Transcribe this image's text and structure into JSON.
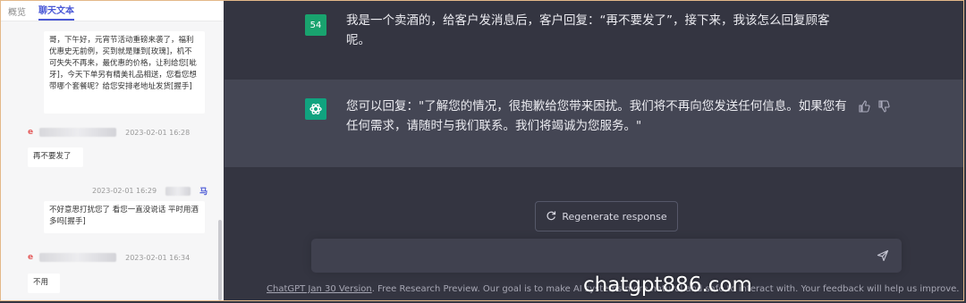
{
  "left_panel": {
    "tabs": [
      "概览",
      "聊天文本"
    ],
    "active_tab": 1,
    "messages": [
      {
        "text": "哥，下午好，元宵节活动重磅来袭了，福利优惠史无前例，买到就是赚到[玫瑰]，机不可失失不再来，最优惠的价格，让利给您[呲牙]，今天下单另有精美礼品相送，您看您想带哪个套餐呢？给您安排老地址发货[握手]"
      },
      {
        "marker": "e",
        "time": "2023-02-01 16:28",
        "text": "再不要发了"
      },
      {
        "time": "2023-02-01 16:29",
        "marker": "马",
        "text": "不好意思打扰您了 看您一直没说话 平时用酒多吗[握手]"
      },
      {
        "marker": "e",
        "time": "2023-02-01 16:34",
        "text": "不用"
      }
    ]
  },
  "chat": {
    "user_avatar": "54",
    "user_message": "我是一个卖酒的，给客户发消息后，客户回复：“再不要发了”，接下来，我该怎么回复顾客呢。",
    "assistant_message": "您可以回复：\"了解您的情况，很抱歉给您带来困扰。我们将不再向您发送任何信息。如果您有任何需求，请随时与我们联系。我们将竭诚为您服务。\"",
    "regenerate_label": "Regenerate response",
    "input_placeholder": "",
    "footer_link": "ChatGPT Jan 30 Version",
    "footer_text": ". Free Research Preview. Our goal is to make AI systems more natural and safe to interact with. Your feedback will help us improve.",
    "icons": [
      "openai-logo-icon",
      "thumbs-up-icon",
      "thumbs-down-icon",
      "refresh-icon",
      "send-icon"
    ]
  },
  "watermark": "chatgpt886.com",
  "colors": {
    "accent": "#4a58d6",
    "bot_row": "#444654",
    "background": "#343541",
    "avatar": "#10a37f"
  }
}
